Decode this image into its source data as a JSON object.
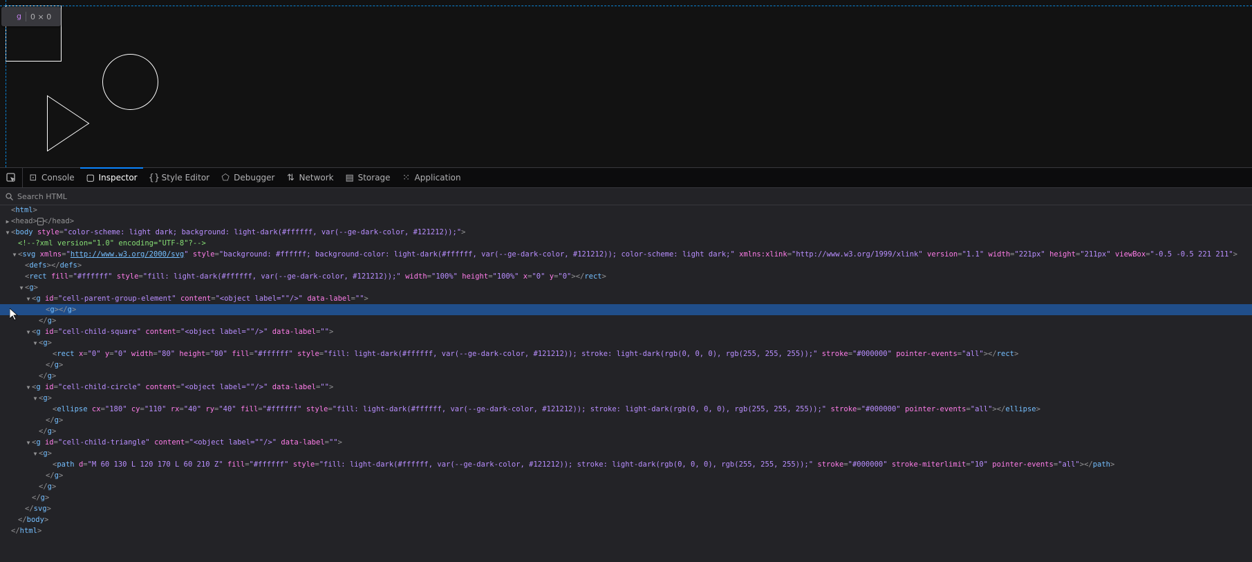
{
  "viewport": {
    "highlight_tag": "g",
    "highlight_dims": "0 × 0",
    "background": "#121212",
    "shape_stroke": "#ffffff"
  },
  "toolbar": {
    "picker_icon": "element-picker-icon",
    "tabs": [
      {
        "label": "Console",
        "icon": "console-icon",
        "active": false
      },
      {
        "label": "Inspector",
        "icon": "inspector-icon",
        "active": true
      },
      {
        "label": "Style Editor",
        "icon": "braces-icon",
        "active": false
      },
      {
        "label": "Debugger",
        "icon": "debugger-icon",
        "active": false
      },
      {
        "label": "Network",
        "icon": "network-arrows-icon",
        "active": false
      },
      {
        "label": "Storage",
        "icon": "storage-icon",
        "active": false
      },
      {
        "label": "Application",
        "icon": "grid-icon",
        "active": false
      }
    ]
  },
  "search": {
    "placeholder": "Search HTML",
    "value": ""
  },
  "markup": {
    "accent_selected": "#204e8a",
    "lines": [
      {
        "indent": 0,
        "twisty": "",
        "html": "<span class='pn'>&lt;</span><span class='tn'>html</span><span class='pn'>&gt;</span>"
      },
      {
        "indent": 0,
        "twisty": "▶",
        "html": "<span class='pn'>&lt;head&gt;</span><span class='ellip'>⋯</span><span class='pn'>&lt;/head&gt;</span>"
      },
      {
        "indent": 0,
        "twisty": "▼",
        "html": "<span class='pn'>&lt;</span><span class='tn'>body</span> <span class='an'>style</span><span class='pn'>=</span><span class='av'>\"color-scheme: light dark; background: light-dark(#ffffff, var(--ge-dark-color, #121212));\"</span><span class='pn'>&gt;</span>"
      },
      {
        "indent": 1,
        "twisty": "",
        "html": "<span class='cm'>&lt;!--?xml version=\"1.0\" encoding=\"UTF-8\"?--&gt;</span>"
      },
      {
        "indent": 1,
        "twisty": "▼",
        "html": "<span class='pn'>&lt;</span><span class='tn'>svg</span> <span class='an'>xmlns</span><span class='pn'>=</span><span class='av'>\"</span><span class='ln'>http://www.w3.org/2000/svg</span><span class='av'>\"</span> <span class='an'>style</span><span class='pn'>=</span><span class='av'>\"background: #ffffff; background-color: light-dark(#ffffff, var(--ge-dark-color, #121212)); color-scheme: light dark;\"</span> <span class='an'>xmlns:xlink</span><span class='pn'>=</span><span class='av'>\"http://www.w3.org/1999/xlink\"</span> <span class='an'>version</span><span class='pn'>=</span><span class='av'>\"1.1\"</span> <span class='an'>width</span><span class='pn'>=</span><span class='av'>\"221px\"</span> <span class='an'>height</span><span class='pn'>=</span><span class='av'>\"211px\"</span> <span class='an'>viewBox</span><span class='pn'>=</span><span class='av'>\"-0.5 -0.5 221 211\"</span><span class='pn'>&gt;</span>"
      },
      {
        "indent": 2,
        "twisty": "",
        "html": "<span class='pn'>&lt;</span><span class='tn'>defs</span><span class='pn'>&gt;&lt;/</span><span class='tn'>defs</span><span class='pn'>&gt;</span>"
      },
      {
        "indent": 2,
        "twisty": "",
        "html": "<span class='pn'>&lt;</span><span class='tn'>rect</span> <span class='an'>fill</span><span class='pn'>=</span><span class='av'>\"#ffffff\"</span> <span class='an'>style</span><span class='pn'>=</span><span class='av'>\"fill: light-dark(#ffffff, var(--ge-dark-color, #121212));\"</span> <span class='an'>width</span><span class='pn'>=</span><span class='av'>\"100%\"</span> <span class='an'>height</span><span class='pn'>=</span><span class='av'>\"100%\"</span> <span class='an'>x</span><span class='pn'>=</span><span class='av'>\"0\"</span> <span class='an'>y</span><span class='pn'>=</span><span class='av'>\"0\"</span><span class='pn'>&gt;&lt;/</span><span class='tn'>rect</span><span class='pn'>&gt;</span>"
      },
      {
        "indent": 2,
        "twisty": "▼",
        "html": "<span class='pn'>&lt;</span><span class='tn'>g</span><span class='pn'>&gt;</span>"
      },
      {
        "indent": 3,
        "twisty": "▼",
        "html": "<span class='pn'>&lt;</span><span class='tn'>g</span> <span class='an'>id</span><span class='pn'>=</span><span class='av'>\"cell-parent-group-element\"</span> <span class='an'>content</span><span class='pn'>=</span><span class='av'>\"&lt;object label=\"\"/&gt;\"</span> <span class='an'>data-label</span><span class='pn'>=</span><span class='av'>\"\"</span><span class='pn'>&gt;</span>"
      },
      {
        "indent": 5,
        "twisty": "",
        "selected": true,
        "html": "<span class='pn'>&lt;</span><span class='tn'>g</span><span class='pn'>&gt;&lt;/</span><span class='tn'>g</span><span class='pn'>&gt;</span>"
      },
      {
        "indent": 4,
        "twisty": "",
        "html": "<span class='pn'>&lt;/</span><span class='tn'>g</span><span class='pn'>&gt;</span>"
      },
      {
        "indent": 3,
        "twisty": "▼",
        "html": "<span class='pn'>&lt;</span><span class='tn'>g</span> <span class='an'>id</span><span class='pn'>=</span><span class='av'>\"cell-child-square\"</span> <span class='an'>content</span><span class='pn'>=</span><span class='av'>\"&lt;object label=\"\"/&gt;\"</span> <span class='an'>data-label</span><span class='pn'>=</span><span class='av'>\"\"</span><span class='pn'>&gt;</span>"
      },
      {
        "indent": 4,
        "twisty": "▼",
        "html": "<span class='pn'>&lt;</span><span class='tn'>g</span><span class='pn'>&gt;</span>"
      },
      {
        "indent": 6,
        "twisty": "",
        "html": "<span class='pn'>&lt;</span><span class='tn'>rect</span> <span class='an'>x</span><span class='pn'>=</span><span class='av'>\"0\"</span> <span class='an'>y</span><span class='pn'>=</span><span class='av'>\"0\"</span> <span class='an'>width</span><span class='pn'>=</span><span class='av'>\"80\"</span> <span class='an'>height</span><span class='pn'>=</span><span class='av'>\"80\"</span> <span class='an'>fill</span><span class='pn'>=</span><span class='av'>\"#ffffff\"</span> <span class='an'>style</span><span class='pn'>=</span><span class='av'>\"fill: light-dark(#ffffff, var(--ge-dark-color, #121212)); stroke: light-dark(rgb(0, 0, 0), rgb(255, 255, 255));\"</span> <span class='an'>stroke</span><span class='pn'>=</span><span class='av'>\"#000000\"</span> <span class='an'>pointer-events</span><span class='pn'>=</span><span class='av'>\"all\"</span><span class='pn'>&gt;&lt;/</span><span class='tn'>rect</span><span class='pn'>&gt;</span>"
      },
      {
        "indent": 5,
        "twisty": "",
        "html": "<span class='pn'>&lt;/</span><span class='tn'>g</span><span class='pn'>&gt;</span>"
      },
      {
        "indent": 4,
        "twisty": "",
        "html": "<span class='pn'>&lt;/</span><span class='tn'>g</span><span class='pn'>&gt;</span>"
      },
      {
        "indent": 3,
        "twisty": "▼",
        "html": "<span class='pn'>&lt;</span><span class='tn'>g</span> <span class='an'>id</span><span class='pn'>=</span><span class='av'>\"cell-child-circle\"</span> <span class='an'>content</span><span class='pn'>=</span><span class='av'>\"&lt;object label=\"\"/&gt;\"</span> <span class='an'>data-label</span><span class='pn'>=</span><span class='av'>\"\"</span><span class='pn'>&gt;</span>"
      },
      {
        "indent": 4,
        "twisty": "▼",
        "html": "<span class='pn'>&lt;</span><span class='tn'>g</span><span class='pn'>&gt;</span>"
      },
      {
        "indent": 6,
        "twisty": "",
        "html": "<span class='pn'>&lt;</span><span class='tn'>ellipse</span> <span class='an'>cx</span><span class='pn'>=</span><span class='av'>\"180\"</span> <span class='an'>cy</span><span class='pn'>=</span><span class='av'>\"110\"</span> <span class='an'>rx</span><span class='pn'>=</span><span class='av'>\"40\"</span> <span class='an'>ry</span><span class='pn'>=</span><span class='av'>\"40\"</span> <span class='an'>fill</span><span class='pn'>=</span><span class='av'>\"#ffffff\"</span> <span class='an'>style</span><span class='pn'>=</span><span class='av'>\"fill: light-dark(#ffffff, var(--ge-dark-color, #121212)); stroke: light-dark(rgb(0, 0, 0), rgb(255, 255, 255));\"</span> <span class='an'>stroke</span><span class='pn'>=</span><span class='av'>\"#000000\"</span> <span class='an'>pointer-events</span><span class='pn'>=</span><span class='av'>\"all\"</span><span class='pn'>&gt;&lt;/</span><span class='tn'>ellipse</span><span class='pn'>&gt;</span>"
      },
      {
        "indent": 5,
        "twisty": "",
        "html": "<span class='pn'>&lt;/</span><span class='tn'>g</span><span class='pn'>&gt;</span>"
      },
      {
        "indent": 4,
        "twisty": "",
        "html": "<span class='pn'>&lt;/</span><span class='tn'>g</span><span class='pn'>&gt;</span>"
      },
      {
        "indent": 3,
        "twisty": "▼",
        "html": "<span class='pn'>&lt;</span><span class='tn'>g</span> <span class='an'>id</span><span class='pn'>=</span><span class='av'>\"cell-child-triangle\"</span> <span class='an'>content</span><span class='pn'>=</span><span class='av'>\"&lt;object label=\"\"/&gt;\"</span> <span class='an'>data-label</span><span class='pn'>=</span><span class='av'>\"\"</span><span class='pn'>&gt;</span>"
      },
      {
        "indent": 4,
        "twisty": "▼",
        "html": "<span class='pn'>&lt;</span><span class='tn'>g</span><span class='pn'>&gt;</span>"
      },
      {
        "indent": 6,
        "twisty": "",
        "html": "<span class='pn'>&lt;</span><span class='tn'>path</span> <span class='an'>d</span><span class='pn'>=</span><span class='av'>\"M 60 130 L 120 170 L 60 210 Z\"</span> <span class='an'>fill</span><span class='pn'>=</span><span class='av'>\"#ffffff\"</span> <span class='an'>style</span><span class='pn'>=</span><span class='av'>\"fill: light-dark(#ffffff, var(--ge-dark-color, #121212)); stroke: light-dark(rgb(0, 0, 0), rgb(255, 255, 255));\"</span> <span class='an'>stroke</span><span class='pn'>=</span><span class='av'>\"#000000\"</span> <span class='an'>stroke-miterlimit</span><span class='pn'>=</span><span class='av'>\"10\"</span> <span class='an'>pointer-events</span><span class='pn'>=</span><span class='av'>\"all\"</span><span class='pn'>&gt;&lt;/</span><span class='tn'>path</span><span class='pn'>&gt;</span>"
      },
      {
        "indent": 5,
        "twisty": "",
        "html": "<span class='pn'>&lt;/</span><span class='tn'>g</span><span class='pn'>&gt;</span>"
      },
      {
        "indent": 4,
        "twisty": "",
        "html": "<span class='pn'>&lt;/</span><span class='tn'>g</span><span class='pn'>&gt;</span>"
      },
      {
        "indent": 3,
        "twisty": "",
        "html": "<span class='pn'>&lt;/</span><span class='tn'>g</span><span class='pn'>&gt;</span>"
      },
      {
        "indent": 2,
        "twisty": "",
        "html": "<span class='pn'>&lt;/</span><span class='tn'>svg</span><span class='pn'>&gt;</span>"
      },
      {
        "indent": 1,
        "twisty": "",
        "html": "<span class='pn'>&lt;/</span><span class='tn'>body</span><span class='pn'>&gt;</span>"
      },
      {
        "indent": 0,
        "twisty": "",
        "html": "<span class='pn'>&lt;/</span><span class='tn'>html</span><span class='pn'>&gt;</span>"
      }
    ]
  }
}
